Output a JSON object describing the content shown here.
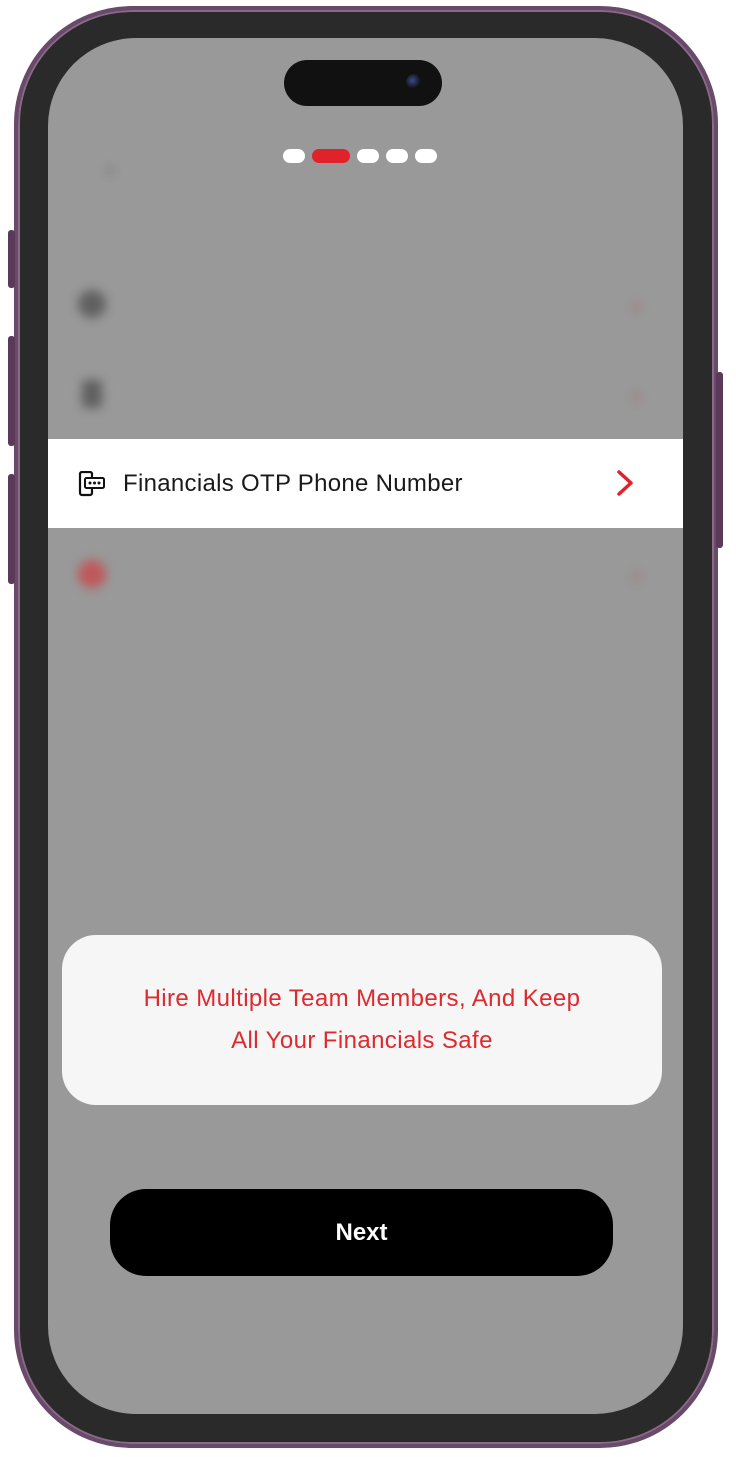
{
  "onboarding": {
    "step_count": 5,
    "active_step": 2
  },
  "highlighted_row": {
    "label": "Financials OTP Phone Number",
    "icon": "phone-otp-icon",
    "chevron_icon": "chevron-right-icon"
  },
  "tip_card": {
    "line1": "Hire Multiple Team Members, And Keep",
    "line2": "All Your Financials Safe"
  },
  "next_button": {
    "label": "Next"
  },
  "colors": {
    "accent": "#e0232a",
    "overlay": "#999999",
    "button": "#000000"
  }
}
